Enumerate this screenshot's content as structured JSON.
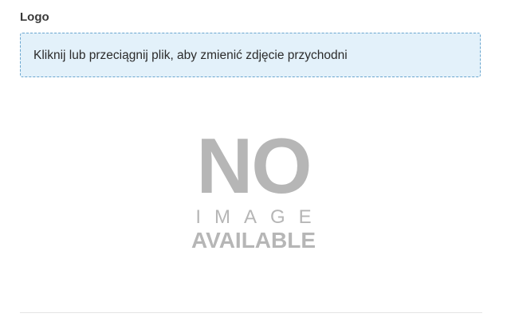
{
  "logo_section": {
    "label": "Logo",
    "dropzone_text": "Kliknij lub przeciągnij plik, aby zmienić zdjęcie przychodni",
    "placeholder_image": {
      "line1": "NO",
      "line2": "IMAGE",
      "line3": "AVAILABLE"
    }
  },
  "colors": {
    "dropzone_background": "#e3f1fa",
    "dropzone_border": "#6aa6cf",
    "placeholder_text": "#b6b6b6"
  }
}
